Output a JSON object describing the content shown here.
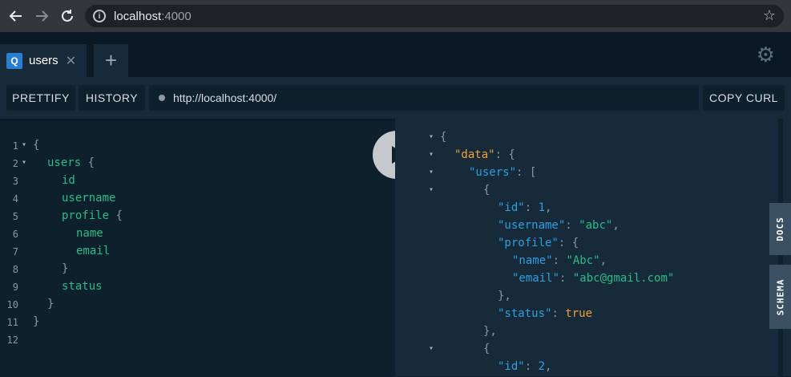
{
  "browser": {
    "url_host": "localhost",
    "url_port": ":4000",
    "icons": [
      "back-arrow-icon",
      "forward-arrow-icon",
      "reload-icon",
      "info-icon",
      "star-icon"
    ]
  },
  "tabs": [
    {
      "badge": "Q",
      "label": "users",
      "close": "✕"
    }
  ],
  "add_tab": "+",
  "toolbar": {
    "prettify": "PRETTIFY",
    "history": "HISTORY",
    "endpoint": "http://localhost:4000/",
    "copy_curl": "COPY CURL"
  },
  "editor": {
    "lines": [
      {
        "num": "1",
        "fold": true,
        "indent": 0,
        "parts": [
          [
            "punc",
            "{"
          ]
        ]
      },
      {
        "num": "2",
        "fold": true,
        "indent": 1,
        "parts": [
          [
            "kw",
            "users "
          ],
          [
            "punc",
            "{"
          ]
        ]
      },
      {
        "num": "3",
        "fold": false,
        "indent": 2,
        "parts": [
          [
            "kw",
            "id"
          ]
        ]
      },
      {
        "num": "4",
        "fold": false,
        "indent": 2,
        "parts": [
          [
            "kw",
            "username"
          ]
        ]
      },
      {
        "num": "5",
        "fold": false,
        "indent": 2,
        "parts": [
          [
            "kw",
            "profile "
          ],
          [
            "punc",
            "{"
          ]
        ]
      },
      {
        "num": "6",
        "fold": false,
        "indent": 3,
        "parts": [
          [
            "kw",
            "name"
          ]
        ]
      },
      {
        "num": "7",
        "fold": false,
        "indent": 3,
        "parts": [
          [
            "kw",
            "email"
          ]
        ]
      },
      {
        "num": "8",
        "fold": false,
        "indent": 2,
        "parts": [
          [
            "punc",
            "}"
          ]
        ]
      },
      {
        "num": "9",
        "fold": false,
        "indent": 2,
        "parts": [
          [
            "kw",
            "status"
          ]
        ]
      },
      {
        "num": "10",
        "fold": false,
        "indent": 1,
        "parts": [
          [
            "punc",
            "}"
          ]
        ]
      },
      {
        "num": "11",
        "fold": false,
        "indent": 0,
        "parts": [
          [
            "punc",
            "}"
          ]
        ]
      },
      {
        "num": "12",
        "fold": false,
        "indent": 0,
        "parts": []
      }
    ]
  },
  "result": {
    "lines": [
      {
        "fold": true,
        "indent": 0,
        "parts": [
          [
            "punc",
            "{"
          ]
        ]
      },
      {
        "fold": true,
        "indent": 1,
        "parts": [
          [
            "key-data",
            "\"data\""
          ],
          [
            "punc",
            ": {"
          ]
        ]
      },
      {
        "fold": true,
        "indent": 2,
        "parts": [
          [
            "key",
            "\"users\""
          ],
          [
            "punc",
            ": ["
          ]
        ]
      },
      {
        "fold": true,
        "indent": 3,
        "parts": [
          [
            "punc",
            "{"
          ]
        ]
      },
      {
        "fold": false,
        "indent": 4,
        "parts": [
          [
            "key",
            "\"id\""
          ],
          [
            "punc",
            ": "
          ],
          [
            "num",
            "1"
          ],
          [
            "punc",
            ","
          ]
        ]
      },
      {
        "fold": false,
        "indent": 4,
        "parts": [
          [
            "key",
            "\"username\""
          ],
          [
            "punc",
            ": "
          ],
          [
            "str",
            "\"abc\""
          ],
          [
            "punc",
            ","
          ]
        ]
      },
      {
        "fold": false,
        "indent": 4,
        "parts": [
          [
            "key",
            "\"profile\""
          ],
          [
            "punc",
            ": {"
          ]
        ]
      },
      {
        "fold": false,
        "indent": 5,
        "parts": [
          [
            "key",
            "\"name\""
          ],
          [
            "punc",
            ": "
          ],
          [
            "str",
            "\"Abc\""
          ],
          [
            "punc",
            ","
          ]
        ]
      },
      {
        "fold": false,
        "indent": 5,
        "parts": [
          [
            "key",
            "\"email\""
          ],
          [
            "punc",
            ": "
          ],
          [
            "str",
            "\"abc@gmail.com\""
          ]
        ]
      },
      {
        "fold": false,
        "indent": 4,
        "parts": [
          [
            "punc",
            "},"
          ]
        ]
      },
      {
        "fold": false,
        "indent": 4,
        "parts": [
          [
            "key",
            "\"status\""
          ],
          [
            "punc",
            ": "
          ],
          [
            "bool",
            "true"
          ]
        ]
      },
      {
        "fold": false,
        "indent": 3,
        "parts": [
          [
            "punc",
            "},"
          ]
        ]
      },
      {
        "fold": true,
        "indent": 3,
        "parts": [
          [
            "punc",
            "{"
          ]
        ]
      },
      {
        "fold": false,
        "indent": 4,
        "parts": [
          [
            "key",
            "\"id\""
          ],
          [
            "punc",
            ": "
          ],
          [
            "num",
            "2"
          ],
          [
            "punc",
            ","
          ]
        ]
      }
    ]
  },
  "side_tabs": {
    "docs": "DOCS",
    "schema": "SCHEMA"
  },
  "colors": {
    "background": "#0f202d",
    "panel": "#172a3a",
    "keyword": "#2bbc8a",
    "json_key": "#2e9fe0",
    "json_data_key": "#f0a235"
  }
}
